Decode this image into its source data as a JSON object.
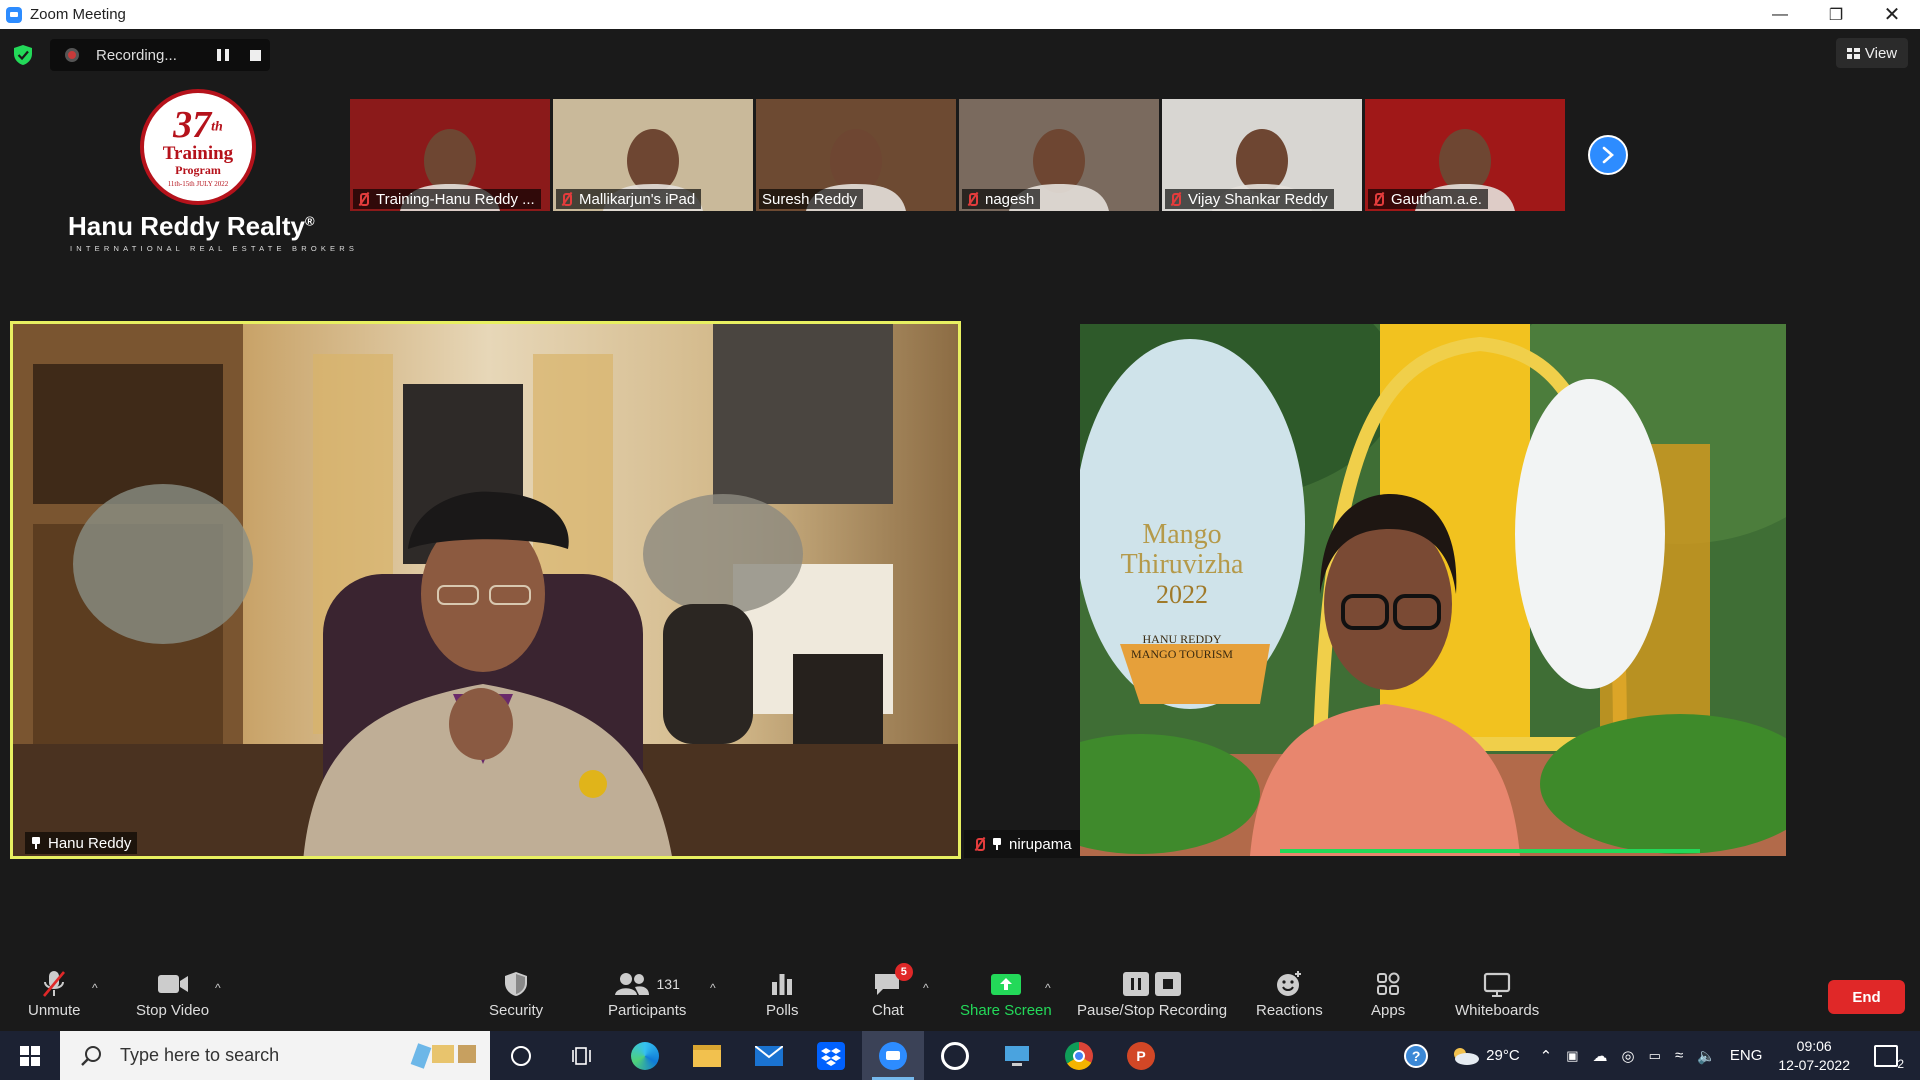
{
  "window": {
    "title": "Zoom Meeting"
  },
  "recording": {
    "status": "Recording..."
  },
  "view": {
    "label": "View"
  },
  "logo": {
    "seal_number": "37",
    "seal_suffix": "th",
    "seal_line1": "Training",
    "seal_line2": "Program",
    "seal_dates": "11th-15th JULY 2022",
    "brand": "Hanu Reddy Realty",
    "brand_mark": "®",
    "tagline": "INTERNATIONAL REAL ESTATE BROKERS"
  },
  "participants_strip": [
    {
      "name": "Training-Hanu Reddy ...",
      "muted": true,
      "bg": "#8b1a1a"
    },
    {
      "name": "Mallikarjun's iPad",
      "muted": true,
      "bg": "#c9b99a"
    },
    {
      "name": "Suresh Reddy",
      "muted": false,
      "bg": "#6d4a32"
    },
    {
      "name": "nagesh",
      "muted": true,
      "bg": "#7a6a5e"
    },
    {
      "name": "Vijay Shankar Reddy",
      "muted": true,
      "bg": "#d8d6d2"
    },
    {
      "name": "Gautham.a.e.",
      "muted": true,
      "bg": "#a01818"
    }
  ],
  "main_tile": {
    "name": "Hanu Reddy"
  },
  "side_tile": {
    "name": "nirupama",
    "sign_line1": "Mango",
    "sign_line2": "Thiruvizha",
    "sign_year": "2022",
    "sign_sub1": "HANU REDDY",
    "sign_sub2": "MANGO TOURISM"
  },
  "toolbar": {
    "unmute": "Unmute",
    "stop_video": "Stop Video",
    "security": "Security",
    "participants": "Participants",
    "participants_count": "131",
    "polls": "Polls",
    "chat": "Chat",
    "chat_badge": "5",
    "share_screen": "Share Screen",
    "pause_recording": "Pause/Stop Recording",
    "reactions": "Reactions",
    "apps": "Apps",
    "whiteboards": "Whiteboards",
    "end": "End"
  },
  "taskbar": {
    "search_placeholder": "Type here to search",
    "temperature": "29°C",
    "language": "ENG",
    "time": "09:06",
    "date": "12-07-2022",
    "notifications": "2"
  },
  "colors": {
    "zoom_blue": "#2d8cff",
    "end_red": "#e02828",
    "active_speaker": "#e8f061",
    "share_green": "#23d959",
    "brand_red": "#b5121b"
  }
}
